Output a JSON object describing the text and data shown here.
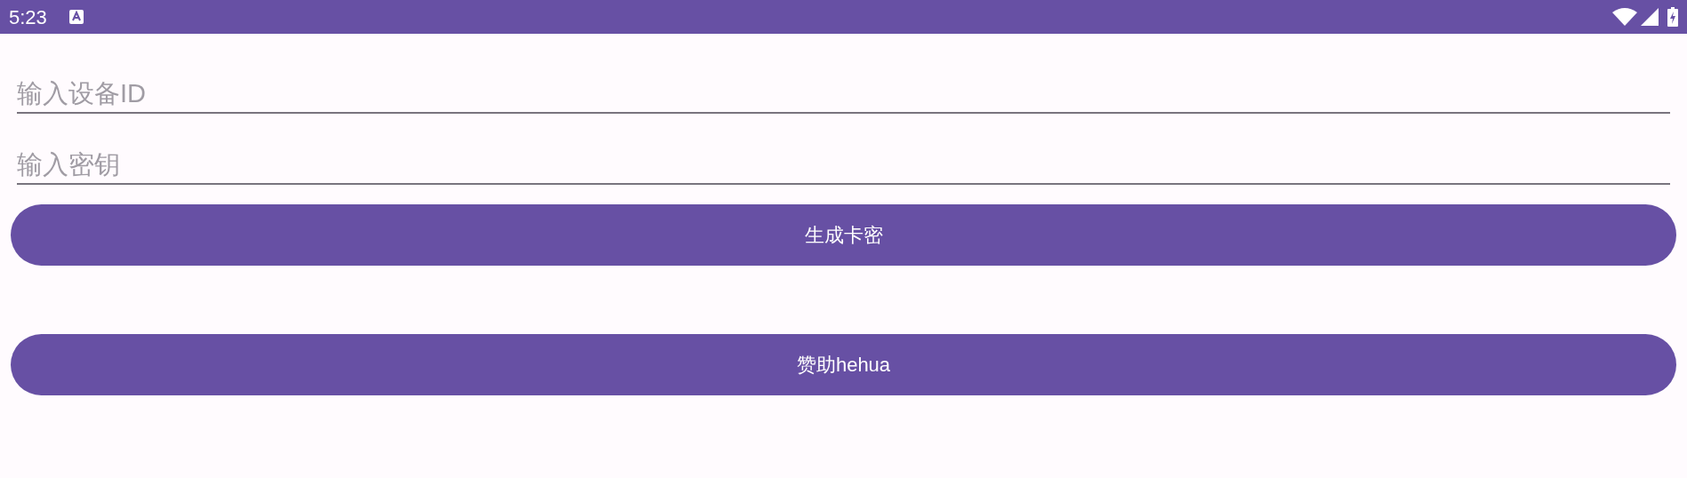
{
  "status_bar": {
    "time": "5:23"
  },
  "fields": [
    {
      "placeholder": "输入设备ID"
    },
    {
      "placeholder": "输入密钥"
    }
  ],
  "buttons": [
    {
      "label": "生成卡密"
    },
    {
      "label": "赞助hehua"
    }
  ]
}
